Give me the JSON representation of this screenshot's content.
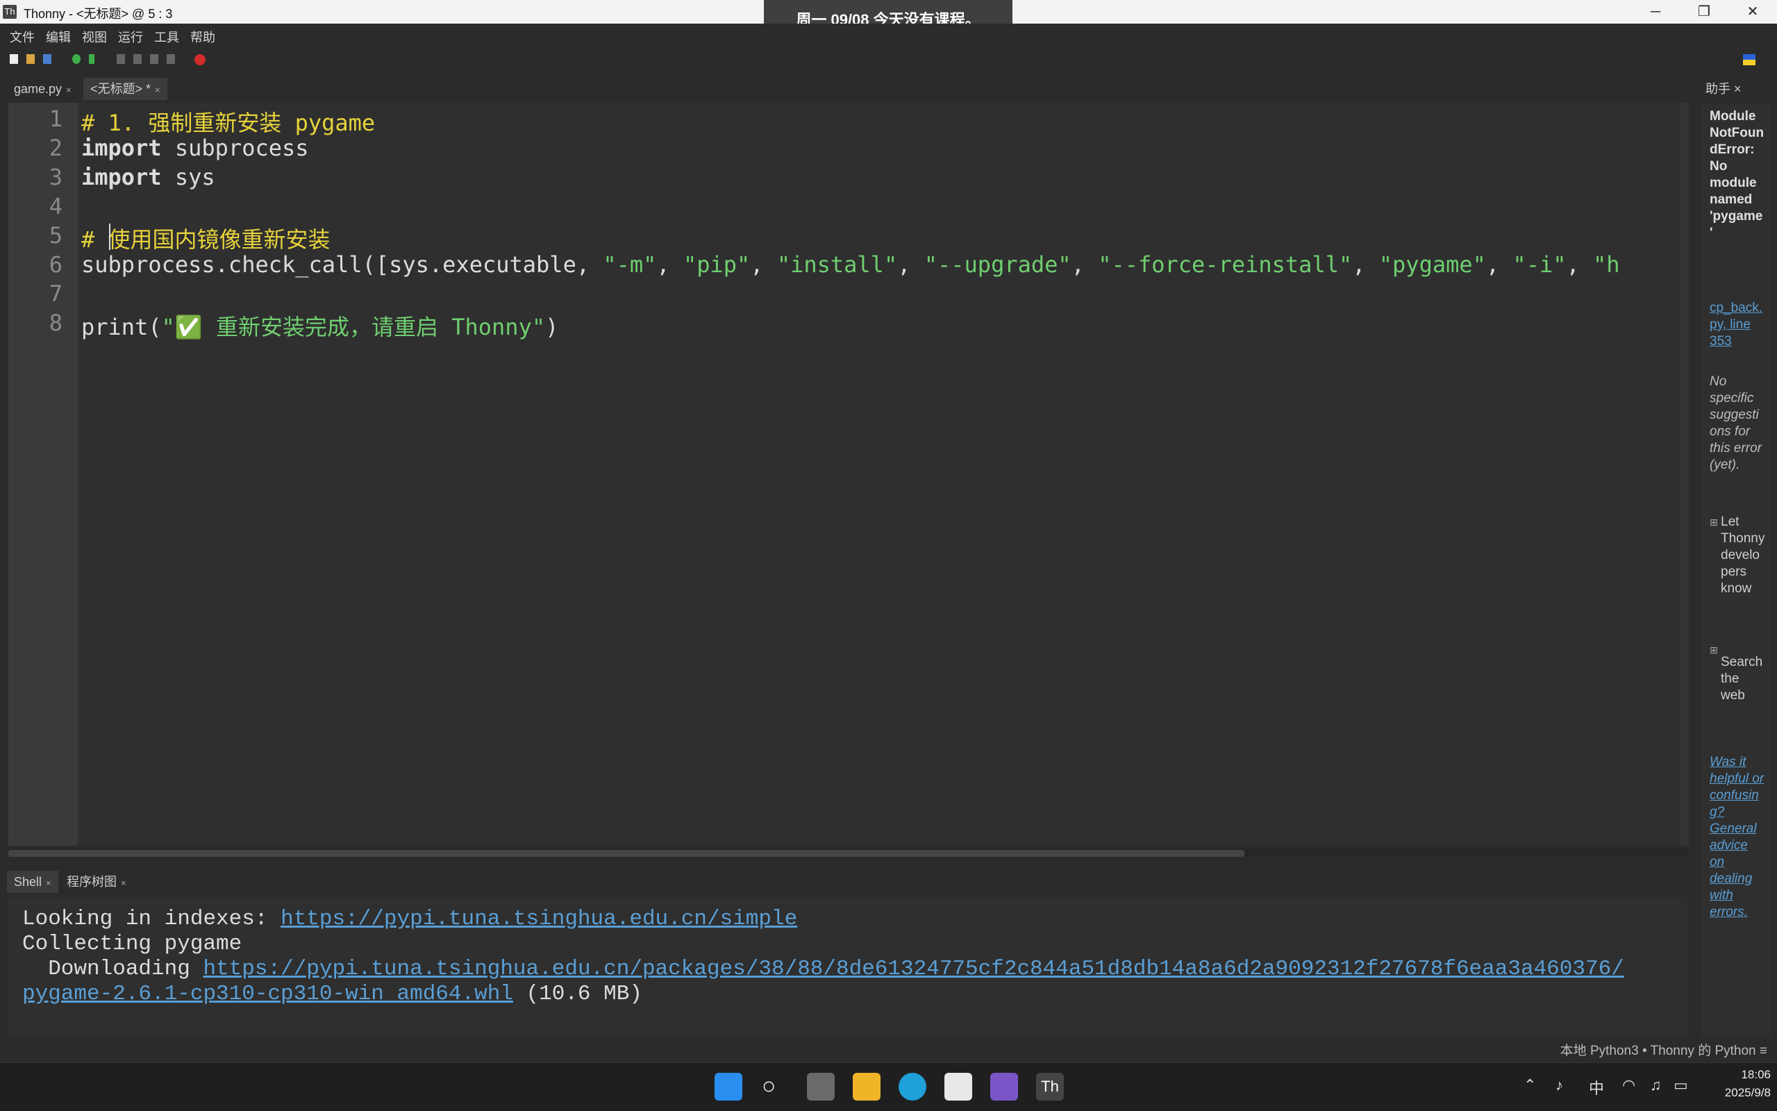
{
  "window": {
    "title": "Thonny  -  <无标题>  @  5 : 3",
    "app_icon": "Th",
    "minimize": "─",
    "maximize": "❐",
    "close": "✕"
  },
  "notification": "周一 09/08   今天没有课程。",
  "menu": [
    "文件",
    "编辑",
    "视图",
    "运行",
    "工具",
    "帮助"
  ],
  "tabs": [
    {
      "label": "game.py",
      "close": "×"
    },
    {
      "label": "<无标题> *",
      "close": "×"
    }
  ],
  "editor": {
    "line_numbers": [
      "1",
      "2",
      "3",
      "4",
      "5",
      "6",
      "7",
      "8"
    ],
    "line1": "# 1. 强制重新安装 pygame",
    "line2_kw": "import",
    "line2_rest": " subprocess",
    "line3_kw": "import",
    "line3_rest": " sys",
    "line5": "# 使用国内镜像重新安装",
    "line6_a": "subprocess.check_call([sys.executable, ",
    "line6_s1": "\"-m\"",
    "line6_c1": ", ",
    "line6_s2": "\"pip\"",
    "line6_c2": ", ",
    "line6_s3": "\"install\"",
    "line6_c3": ", ",
    "line6_s4": "\"--upgrade\"",
    "line6_c4": ", ",
    "line6_s5": "\"--force-reinstall\"",
    "line6_c5": ", ",
    "line6_s6": "\"pygame\"",
    "line6_c6": ", ",
    "line6_s7": "\"-i\"",
    "line6_c7": ", ",
    "line6_s8": "\"h",
    "line8_a": "print(",
    "line8_s": "\"✅ 重新安装完成，请重启 Thonny\"",
    "line8_b": ")"
  },
  "shell_tabs": [
    {
      "label": "Shell",
      "close": "×"
    },
    {
      "label": "程序树图",
      "close": "×"
    }
  ],
  "shell": {
    "l1_text": "Looking in indexes: ",
    "l1_link": "https://pypi.tuna.tsinghua.edu.cn/simple",
    "l2_text": "Collecting pygame",
    "l3_text": "  Downloading ",
    "l3_link": "https://pypi.tuna.tsinghua.edu.cn/packages/38/88/8de61324775cf2c844a51d8db14a8a6d2a9092312f27678f6eaa3a460376/",
    "l4_link": "pygame-2.6.1-cp310-cp310-win_amd64.whl",
    "l4_text": " (10.6 MB)"
  },
  "assistant": {
    "tab_label": "助手 ×",
    "error": "ModuleNotFoundError: No module named 'pygame'",
    "location": "cp_back.py, line 353",
    "note": "No specific suggestions for this error (yet).",
    "item1": "Let Thonny developers know",
    "item2": "Search the web",
    "feedback": "Was it helpful or confusing? General advice on dealing with errors."
  },
  "statusbar": "本地 Python3  •  Thonny 的 Python  ≡",
  "clock": {
    "time": "18:06",
    "date": "2025/9/8"
  },
  "tray": {
    "ime": "中"
  },
  "colors": {
    "accent_link": "#5a9fd6",
    "comment": "#e6d23c",
    "string": "#6fce6f"
  }
}
